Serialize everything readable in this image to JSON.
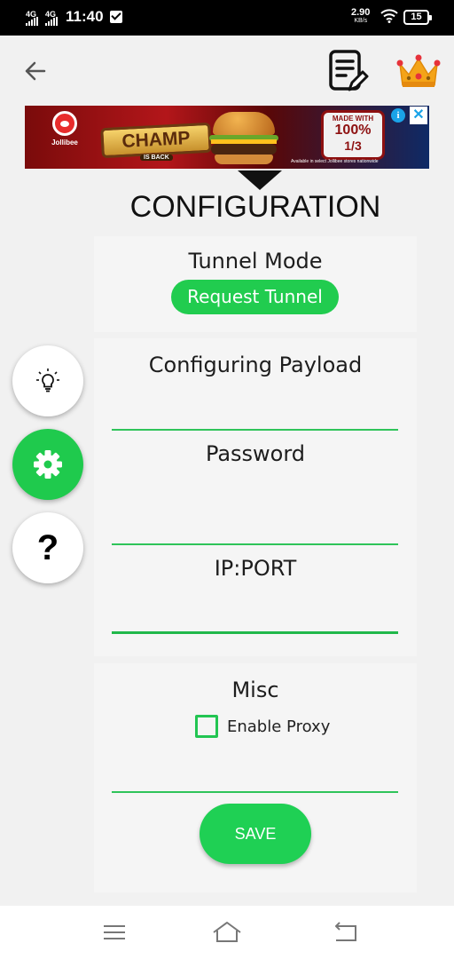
{
  "status_bar": {
    "network_1": "4G",
    "network_2": "4G",
    "time": "11:40",
    "speed_value": "2.90",
    "speed_unit": "KB/s",
    "battery": "15"
  },
  "ad": {
    "brand": "Jollibee",
    "headline": "CHAMP",
    "sub": "IS BACK",
    "badge_top": "MADE WITH",
    "badge_pct": "100%",
    "badge_text": "PURE BEEF",
    "badge_third": "1/3",
    "badge_bottom": "POUND PATTY",
    "availability": "Available in select Jollibee stores nationwide",
    "info_icon": "i",
    "close_icon": "✕"
  },
  "page": {
    "title": "CONFIGURATION"
  },
  "tunnel": {
    "label": "Tunnel Mode",
    "mode_button": "Request Tunnel"
  },
  "payload": {
    "label": "Configuring Payload",
    "password_label": "Password",
    "ipport_label": "IP:PORT"
  },
  "misc": {
    "label": "Misc",
    "checkbox_label": "Enable Proxy",
    "checkbox_checked": false,
    "save_label": "SAVE"
  },
  "side_buttons": {
    "help_label": "?"
  },
  "colors": {
    "accent": "#21cc4f",
    "card_bg": "#f5f5f5",
    "page_bg": "#f1f1f1"
  },
  "icons": {
    "back": "arrow-left-icon",
    "notes": "edit-document-icon",
    "premium": "crown-icon",
    "tips": "lightbulb-icon",
    "settings": "gear-icon",
    "help": "question-icon",
    "nav_menu": "menu-icon",
    "nav_home": "home-icon",
    "nav_back": "back-icon"
  }
}
